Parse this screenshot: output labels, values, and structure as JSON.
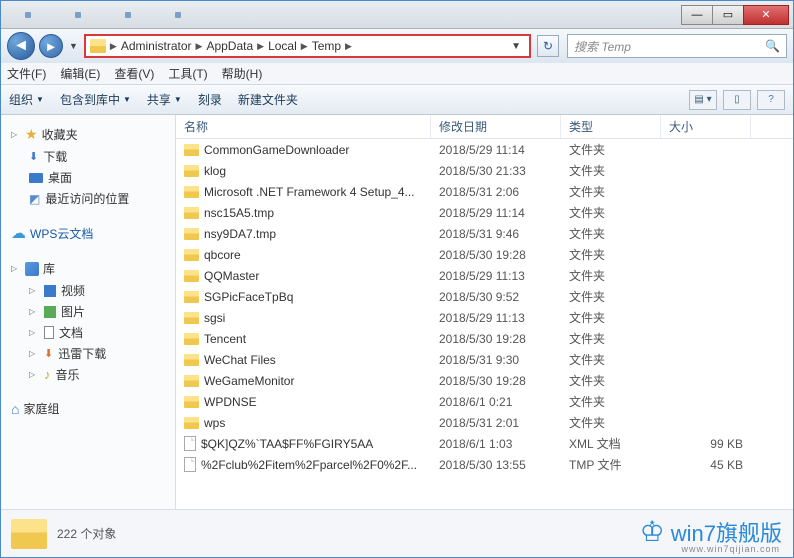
{
  "breadcrumb": [
    "Administrator",
    "AppData",
    "Local",
    "Temp"
  ],
  "search": {
    "placeholder": "搜索 Temp"
  },
  "menubar": [
    "文件(F)",
    "编辑(E)",
    "查看(V)",
    "工具(T)",
    "帮助(H)"
  ],
  "toolbar": {
    "organize": "组织",
    "include": "包含到库中",
    "share": "共享",
    "burn": "刻录",
    "newfolder": "新建文件夹"
  },
  "columns": {
    "name": "名称",
    "date": "修改日期",
    "type": "类型",
    "size": "大小"
  },
  "sidebar": {
    "favorites": "收藏夹",
    "downloads": "下载",
    "desktop": "桌面",
    "recent": "最近访问的位置",
    "wps": "WPS云文档",
    "library": "库",
    "video": "视频",
    "pictures": "图片",
    "documents": "文档",
    "xunlei": "迅雷下载",
    "music": "音乐",
    "homegroup": "家庭组"
  },
  "files": [
    {
      "name": "CommonGameDownloader",
      "date": "2018/5/29 11:14",
      "type": "文件夹",
      "size": "",
      "kind": "folder"
    },
    {
      "name": "klog",
      "date": "2018/5/30 21:33",
      "type": "文件夹",
      "size": "",
      "kind": "folder"
    },
    {
      "name": "Microsoft .NET Framework 4 Setup_4...",
      "date": "2018/5/31 2:06",
      "type": "文件夹",
      "size": "",
      "kind": "folder"
    },
    {
      "name": "nsc15A5.tmp",
      "date": "2018/5/29 11:14",
      "type": "文件夹",
      "size": "",
      "kind": "folder"
    },
    {
      "name": "nsy9DA7.tmp",
      "date": "2018/5/31 9:46",
      "type": "文件夹",
      "size": "",
      "kind": "folder"
    },
    {
      "name": "qbcore",
      "date": "2018/5/30 19:28",
      "type": "文件夹",
      "size": "",
      "kind": "folder"
    },
    {
      "name": "QQMaster",
      "date": "2018/5/29 11:13",
      "type": "文件夹",
      "size": "",
      "kind": "folder"
    },
    {
      "name": "SGPicFaceTpBq",
      "date": "2018/5/30 9:52",
      "type": "文件夹",
      "size": "",
      "kind": "folder"
    },
    {
      "name": "sgsi",
      "date": "2018/5/29 11:13",
      "type": "文件夹",
      "size": "",
      "kind": "folder"
    },
    {
      "name": "Tencent",
      "date": "2018/5/30 19:28",
      "type": "文件夹",
      "size": "",
      "kind": "folder"
    },
    {
      "name": "WeChat Files",
      "date": "2018/5/31 9:30",
      "type": "文件夹",
      "size": "",
      "kind": "folder"
    },
    {
      "name": "WeGameMonitor",
      "date": "2018/5/30 19:28",
      "type": "文件夹",
      "size": "",
      "kind": "folder"
    },
    {
      "name": "WPDNSE",
      "date": "2018/6/1 0:21",
      "type": "文件夹",
      "size": "",
      "kind": "folder"
    },
    {
      "name": "wps",
      "date": "2018/5/31 2:01",
      "type": "文件夹",
      "size": "",
      "kind": "folder"
    },
    {
      "name": "$QK]QZ%`TAA$FF%FGIRY5AA",
      "date": "2018/6/1 1:03",
      "type": "XML 文档",
      "size": "99 KB",
      "kind": "file"
    },
    {
      "name": "%2Fclub%2Fitem%2Fparcel%2F0%2F...",
      "date": "2018/5/30 13:55",
      "type": "TMP 文件",
      "size": "45 KB",
      "kind": "file"
    }
  ],
  "status": {
    "count": "222 个对象"
  },
  "watermark": {
    "text": "win7旗舰版",
    "sub": "www.win7qijian.com"
  }
}
